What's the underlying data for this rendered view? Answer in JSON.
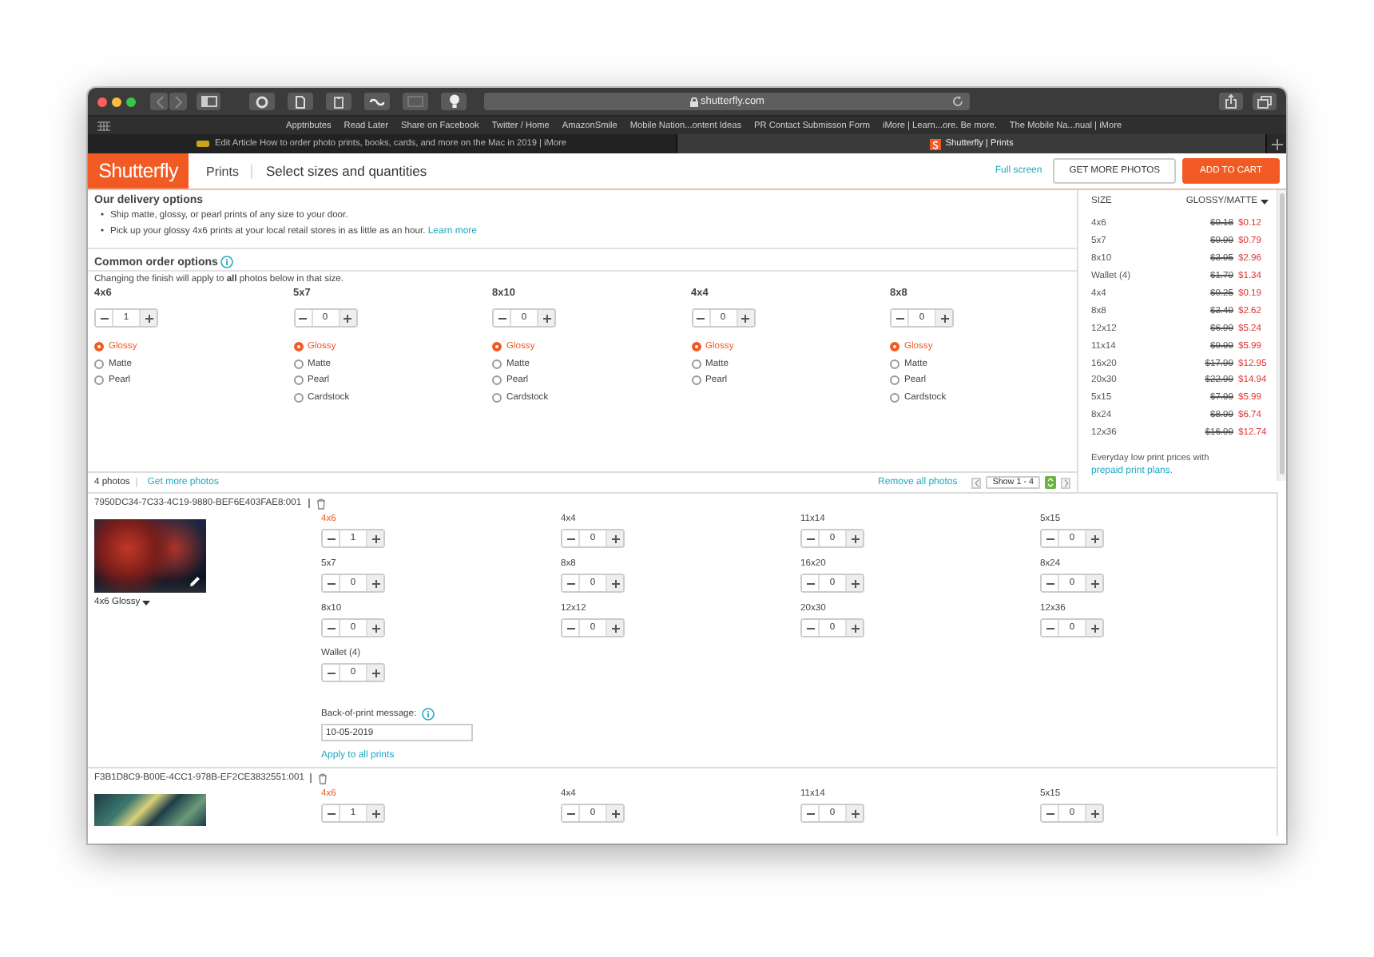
{
  "browser": {
    "address": "shutterfly.com",
    "bookmarks": [
      "Apptributes",
      "Read Later",
      "Share on Facebook",
      "Twitter / Home",
      "AmazonSmile",
      "Mobile Nation...ontent Ideas",
      "PR Contact Submisson Form",
      "iMore | Learn...ore. Be more.",
      "The Mobile Na...nual | iMore"
    ],
    "tabs": [
      {
        "title": "Edit Article How to order photo prints, books, cards, and more on the Mac in 2019 | iMore",
        "selected": false
      },
      {
        "title": "Shutterfly | Prints",
        "selected": true
      }
    ]
  },
  "header": {
    "logo": "Shutterfly",
    "section": "Prints",
    "title": "Select sizes and quantities",
    "full_screen": "Full screen",
    "buttons": [
      {
        "label": "GET MORE PHOTOS",
        "kind": "secondary"
      },
      {
        "label": "ADD TO CART",
        "kind": "primary"
      }
    ]
  },
  "delivery": {
    "title": "Our delivery options",
    "bullets": [
      {
        "marker": "•",
        "text": "Ship matte, glossy, or pearl prints of any size to your door."
      },
      {
        "marker": "•",
        "text": "Pick up your glossy 4x6 prints at your local retail stores in as little as an hour.",
        "link": "Learn more"
      }
    ]
  },
  "common": {
    "title": "Common order options",
    "note": "Changing the finish will apply to **all** photos below in that size.",
    "sizes": [
      {
        "label": "4x6",
        "qty": "1",
        "finishes": [
          {
            "label": "Glossy",
            "selected": true
          },
          {
            "label": "Matte",
            "selected": false
          },
          {
            "label": "Pearl",
            "selected": false
          }
        ]
      },
      {
        "label": "5x7",
        "qty": "0",
        "finishes": [
          {
            "label": "Glossy",
            "selected": true
          },
          {
            "label": "Matte",
            "selected": false
          },
          {
            "label": "Pearl",
            "selected": false
          },
          {
            "label": "Cardstock",
            "selected": false
          }
        ]
      },
      {
        "label": "8x10",
        "qty": "0",
        "finishes": [
          {
            "label": "Glossy",
            "selected": true
          },
          {
            "label": "Matte",
            "selected": false
          },
          {
            "label": "Pearl",
            "selected": false
          },
          {
            "label": "Cardstock",
            "selected": false
          }
        ]
      },
      {
        "label": "4x4",
        "qty": "0",
        "finishes": [
          {
            "label": "Glossy",
            "selected": true
          },
          {
            "label": "Matte",
            "selected": false
          },
          {
            "label": "Pearl",
            "selected": false
          }
        ]
      },
      {
        "label": "8x8",
        "qty": "0",
        "finishes": [
          {
            "label": "Glossy",
            "selected": true
          },
          {
            "label": "Matte",
            "selected": false
          },
          {
            "label": "Pearl",
            "selected": false
          },
          {
            "label": "Cardstock",
            "selected": false
          }
        ]
      }
    ]
  },
  "photo_bar": {
    "count": "4 photos",
    "get_more": "Get more photos",
    "remove_all": "Remove all photos",
    "pager": "Show 1 - 4"
  },
  "prices": {
    "columns": [
      "SIZE",
      "GLOSSY/MATTE"
    ],
    "rows": [
      {
        "size": "4x6",
        "was": "$0.18",
        "now": "$0.12"
      },
      {
        "size": "5x7",
        "was": "$0.99",
        "now": "$0.79"
      },
      {
        "size": "8x10",
        "was": "$3.95",
        "now": "$2.96"
      },
      {
        "size": "Wallet (4)",
        "was": "$1.79",
        "now": "$1.34"
      },
      {
        "size": "4x4",
        "was": "$0.25",
        "now": "$0.19"
      },
      {
        "size": "8x8",
        "was": "$3.49",
        "now": "$2.62"
      },
      {
        "size": "12x12",
        "was": "$6.99",
        "now": "$5.24"
      },
      {
        "size": "11x14",
        "was": "$9.99",
        "now": "$5.99"
      },
      {
        "size": "16x20",
        "was": "$17.99",
        "now": "$12.95"
      },
      {
        "size": "20x30",
        "was": "$22.99",
        "now": "$14.94"
      },
      {
        "size": "5x15",
        "was": "$7.99",
        "now": "$5.99"
      },
      {
        "size": "8x24",
        "was": "$8.99",
        "now": "$6.74"
      },
      {
        "size": "12x36",
        "was": "$16.99",
        "now": "$12.74"
      }
    ],
    "note": "Everyday low print prices with",
    "note_link": "prepaid print plans."
  },
  "photos": [
    {
      "id": "7950DC34-7C33-4C19-9880-BEF6E403FAE8:001",
      "finish": "4x6 Glossy",
      "sizes": [
        {
          "label": "4x6",
          "qty": "1",
          "active": true
        },
        {
          "label": "4x4",
          "qty": "0",
          "active": false
        },
        {
          "label": "11x14",
          "qty": "0",
          "active": false
        },
        {
          "label": "5x15",
          "qty": "0",
          "active": false
        },
        {
          "label": "5x7",
          "qty": "0",
          "active": false
        },
        {
          "label": "8x8",
          "qty": "0",
          "active": false
        },
        {
          "label": "16x20",
          "qty": "0",
          "active": false
        },
        {
          "label": "8x24",
          "qty": "0",
          "active": false
        },
        {
          "label": "8x10",
          "qty": "0",
          "active": false
        },
        {
          "label": "12x12",
          "qty": "0",
          "active": false
        },
        {
          "label": "20x30",
          "qty": "0",
          "active": false
        },
        {
          "label": "12x36",
          "qty": "0",
          "active": false
        },
        {
          "label": "Wallet (4)",
          "qty": "0",
          "active": false
        }
      ],
      "message_label": "Back-of-print message:",
      "message": "10-05-2019",
      "apply": "Apply to all prints"
    },
    {
      "id": "F3B1D8C9-B00E-4CC1-978B-EF2CE3832551:001",
      "sizes": [
        {
          "label": "4x6",
          "qty": "1",
          "active": true
        },
        {
          "label": "4x4",
          "qty": "0",
          "active": false
        },
        {
          "label": "11x14",
          "qty": "0",
          "active": false
        },
        {
          "label": "5x15",
          "qty": "0",
          "active": false
        }
      ]
    }
  ]
}
